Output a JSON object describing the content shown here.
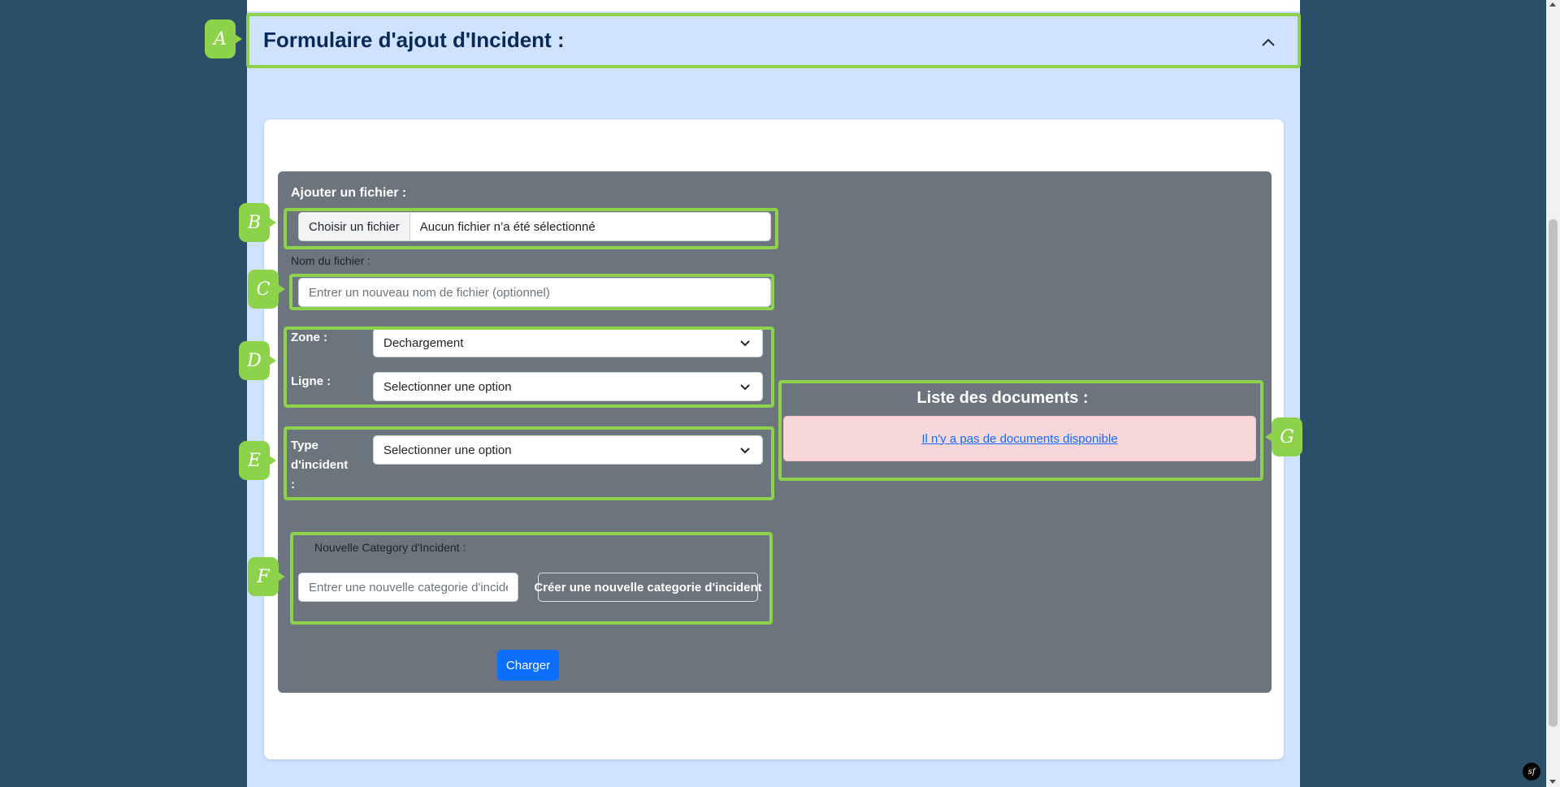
{
  "accordion": {
    "title": "Formulaire d'ajout d'Incident :"
  },
  "form": {
    "add_file_label": "Ajouter un fichier :",
    "file_button": "Choisir un fichier",
    "file_status": "Aucun fichier n’a été sélectionné",
    "file_name_label": "Nom du fichier :",
    "file_name_placeholder": "Entrer un nouveau nom de fichier (optionnel)",
    "zone_label": "Zone :",
    "zone_value": "Dechargement",
    "ligne_label": "Ligne :",
    "ligne_value": "Selectionner une option",
    "type_label": "Type d'incident :",
    "type_value": "Selectionner une option",
    "new_category_label": "Nouvelle Category d'Incident :",
    "new_category_placeholder": "Entrer une nouvelle categorie d'incident",
    "create_category_button": "Créer une nouvelle categorie d'incident",
    "submit_button": "Charger"
  },
  "documents": {
    "title": "Liste des documents :",
    "empty_message": "Il n'y a pas de documents disponible"
  },
  "markers": [
    "A",
    "B",
    "C",
    "D",
    "E",
    "F",
    "G"
  ],
  "colors": {
    "accent_green": "#8cd24a",
    "primary": "#0d6efd",
    "panel": "#6c757d",
    "alert": "#f8d7da",
    "page_bg": "#2b4f66",
    "column_bg": "#cfe2ff"
  },
  "footer": {
    "badge": "sf"
  }
}
